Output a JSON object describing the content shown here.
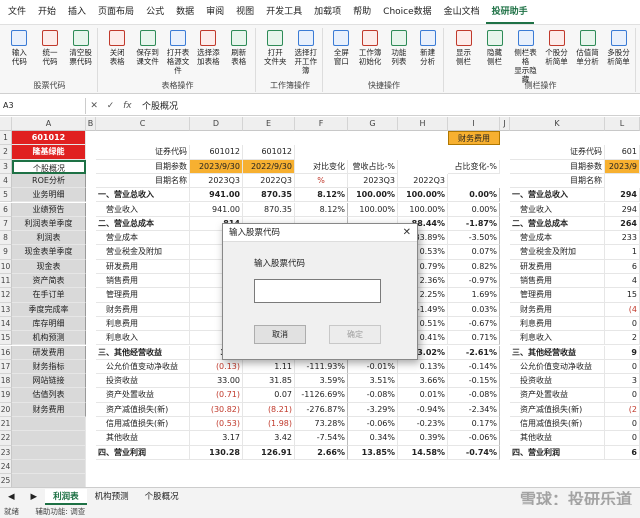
{
  "menu": [
    "文件",
    "开始",
    "插入",
    "页面布局",
    "公式",
    "数据",
    "审阅",
    "视图",
    "开发工具",
    "加载项",
    "帮助",
    "Choice数据",
    "金山文档",
    "投研助手"
  ],
  "ribbon": {
    "groups": [
      {
        "label": "股票代码",
        "buttons": [
          "输入\n代码",
          "统一\n代码",
          "清空股\n票代码"
        ]
      },
      {
        "label": "表格操作",
        "buttons": [
          "关闭\n表格",
          "保存到\n课文件",
          "打开表\n格源文件",
          "选择添\n加表格",
          "刷新\n表格"
        ]
      },
      {
        "label": "工作簿操作",
        "buttons": [
          "打开\n文件夹",
          "选择打\n开工作簿"
        ]
      },
      {
        "label": "快捷操作",
        "buttons": [
          "全屏\n窗口",
          "工作簿\n初始化",
          "功能\n列表",
          "新建\n分析"
        ]
      },
      {
        "label": "侧栏操作",
        "buttons": [
          "显示\n侧栏",
          "隐藏\n侧栏",
          "侧栏表格\n显示隐藏",
          "个股分\n析简单",
          "估值简\n单分析",
          "多股分\n析简单"
        ]
      }
    ]
  },
  "formula": {
    "namebox": "A3",
    "fx": "fx",
    "value": "个股概况"
  },
  "columns": [
    "A",
    "B",
    "C",
    "D",
    "E",
    "F",
    "G",
    "H",
    "I",
    "J",
    "K",
    "L",
    "M"
  ],
  "rows": [
    "1",
    "2",
    "3",
    "4",
    "5",
    "6",
    "7",
    "8",
    "9",
    "10",
    "11",
    "12",
    "13",
    "14",
    "15",
    "16",
    "17",
    "18",
    "19",
    "20",
    "21",
    "22",
    "23",
    "24",
    "25"
  ],
  "sidebar": [
    "601012",
    "隆基绿能",
    "个股概况",
    "ROE分析",
    "业务明细",
    "业绩预告",
    "利润表单季度",
    "利润表",
    "现金表单季度",
    "现金表",
    "资产简表",
    "在手订单",
    "季度完成率",
    "库存明细",
    "机构预测",
    "研发费用",
    "财务指标",
    "网站链接",
    "估值列表",
    "财务费用"
  ],
  "header": {
    "stock_code_label": "证券代码",
    "stock_code_d": "601012",
    "stock_code_e": "601012",
    "date_param_label": "目期参数",
    "date_d": "2023/9/30",
    "date_e": "2022/9/30",
    "date_name_label": "目期名称",
    "name_d": "2023Q3",
    "name_e": "2022Q3",
    "h_yoy": "对比变化",
    "h_rev_pct": "营收占比-%",
    "h_pct": "占比变化-%",
    "h_unit": "%",
    "g_name": "2023Q3",
    "h_name": "2022Q3",
    "fin_tag": "财务费用",
    "right_code": "601",
    "right_date": "2023/9"
  },
  "table": [
    [
      "一、营业总收入",
      "941.00",
      "870.35",
      "8.12%",
      "100.00%",
      "100.00%",
      "0.00%",
      "一、营业总收入",
      "294"
    ],
    [
      "营业收入",
      "941.00",
      "870.35",
      "8.12%",
      "100.00%",
      "100.00%",
      "0.00%",
      "营业收入",
      "294"
    ],
    [
      "二、营业总成本",
      "814",
      "",
      "",
      "",
      "88.44%",
      "-1.87%",
      "二、营业总成本",
      "264"
    ],
    [
      "营业成本",
      "756",
      "",
      "",
      "",
      "83.89%",
      "-3.50%",
      "营业成本",
      "233"
    ],
    [
      "营业税金及附加",
      "",
      "",
      "",
      "",
      "0.53%",
      "0.07%",
      "营业税金及附加",
      "1"
    ],
    [
      "研发费用",
      "",
      "",
      "",
      "",
      "0.79%",
      "0.82%",
      "研发费用",
      "6"
    ],
    [
      "销售费用",
      "",
      "",
      "",
      "",
      "2.36%",
      "-0.97%",
      "销售费用",
      "4"
    ],
    [
      "管理费用",
      "",
      "",
      "",
      "",
      "2.25%",
      "1.69%",
      "管理费用",
      "15"
    ],
    [
      "财务费用",
      "(1",
      "",
      "",
      "",
      "-1.49%",
      "0.03%",
      "财务费用",
      "(4"
    ],
    [
      "利息费用",
      "",
      "",
      "",
      "",
      "0.51%",
      "-0.67%",
      "利息费用",
      "0"
    ],
    [
      "利息收入",
      "",
      "",
      "",
      "",
      "0.41%",
      "0.71%",
      "利息收入",
      "2"
    ],
    [
      "三、其他经营收益",
      "3.87",
      "26.27",
      "-85.29%",
      "0.41%",
      "3.02%",
      "-2.61%",
      "三、其他经营收益",
      "9"
    ],
    [
      "公允价值变动净收益",
      "(0.13)",
      "1.11",
      "-111.93%",
      "-0.01%",
      "0.13%",
      "-0.14%",
      "公允价值变动净收益",
      "0"
    ],
    [
      "投资收益",
      "33.00",
      "31.85",
      "3.59%",
      "3.51%",
      "3.66%",
      "-0.15%",
      "投资收益",
      "3"
    ],
    [
      "资产处置收益",
      "(0.71)",
      "0.07",
      "-1126.69%",
      "-0.08%",
      "0.01%",
      "-0.08%",
      "资产处置收益",
      "0"
    ],
    [
      "资产减值损失(新)",
      "(30.82)",
      "(8.21)",
      "-276.87%",
      "-3.29%",
      "-0.94%",
      "-2.34%",
      "资产减值损失(新)",
      "(2"
    ],
    [
      "信用减值损失(新)",
      "(0.53)",
      "(1.98)",
      "73.28%",
      "-0.06%",
      "-0.23%",
      "0.17%",
      "信用减值损失(新)",
      "0"
    ],
    [
      "其他收益",
      "3.17",
      "3.42",
      "-7.54%",
      "0.34%",
      "0.39%",
      "-0.06%",
      "其他收益",
      "0"
    ],
    [
      "四、营业利润",
      "130.28",
      "126.91",
      "2.66%",
      "13.85%",
      "14.58%",
      "-0.74%",
      "四、营业利润",
      "6"
    ]
  ],
  "dialog": {
    "title": "输入股票代码",
    "label": "输入股票代码",
    "input": "",
    "cancel": "取消",
    "ok": "确定"
  },
  "sheets": [
    "利润表",
    "机构预测",
    "个股概况"
  ],
  "status": {
    "left": "就绪",
    "mid": "辅助功能: 调查"
  },
  "watermark": "雪球：投研乐道",
  "colors": {
    "accent": "#1e7145",
    "code_red": "#e02020",
    "orange": "#f7b030",
    "neg": "#c0392b"
  }
}
